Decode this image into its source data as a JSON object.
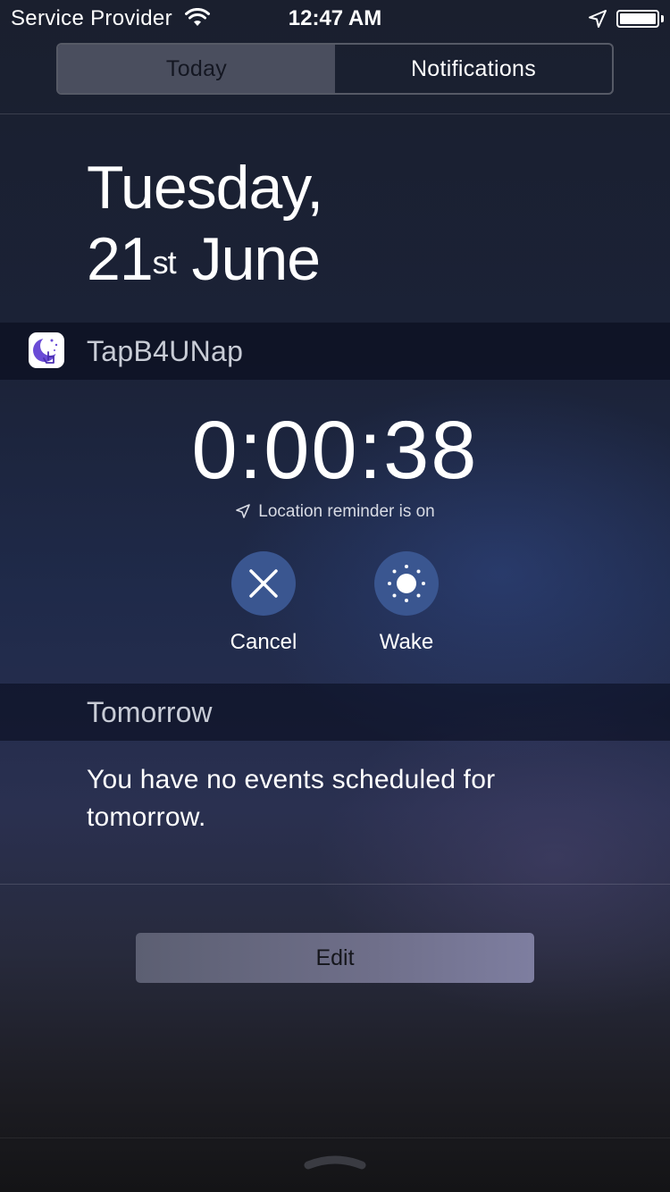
{
  "status_bar": {
    "carrier": "Service Provider",
    "time": "12:47 AM",
    "wifi_icon": "wifi-icon",
    "location_icon": "location-arrow-icon",
    "battery_icon": "battery-icon",
    "battery_level": 1.0
  },
  "tabs": [
    {
      "label": "Today",
      "selected": true
    },
    {
      "label": "Notifications",
      "selected": false
    }
  ],
  "date": {
    "weekday": "Tuesday,",
    "day": "21",
    "suffix": "st",
    "month": "June"
  },
  "widget": {
    "app_name": "TapB4UNap",
    "app_icon": "moon-hand-icon",
    "timer": "0:00:38",
    "location_text": "Location reminder is on",
    "actions": [
      {
        "label": "Cancel",
        "icon": "close-icon"
      },
      {
        "label": "Wake",
        "icon": "sun-icon"
      }
    ]
  },
  "tomorrow": {
    "title": "Tomorrow",
    "message": "You have no events scheduled for tomorrow."
  },
  "edit_button": {
    "label": "Edit"
  },
  "colors": {
    "action_circle": "#3a5690",
    "segment_active": "#4a4e5e",
    "app_icon_purple": "#6a4bd6"
  }
}
